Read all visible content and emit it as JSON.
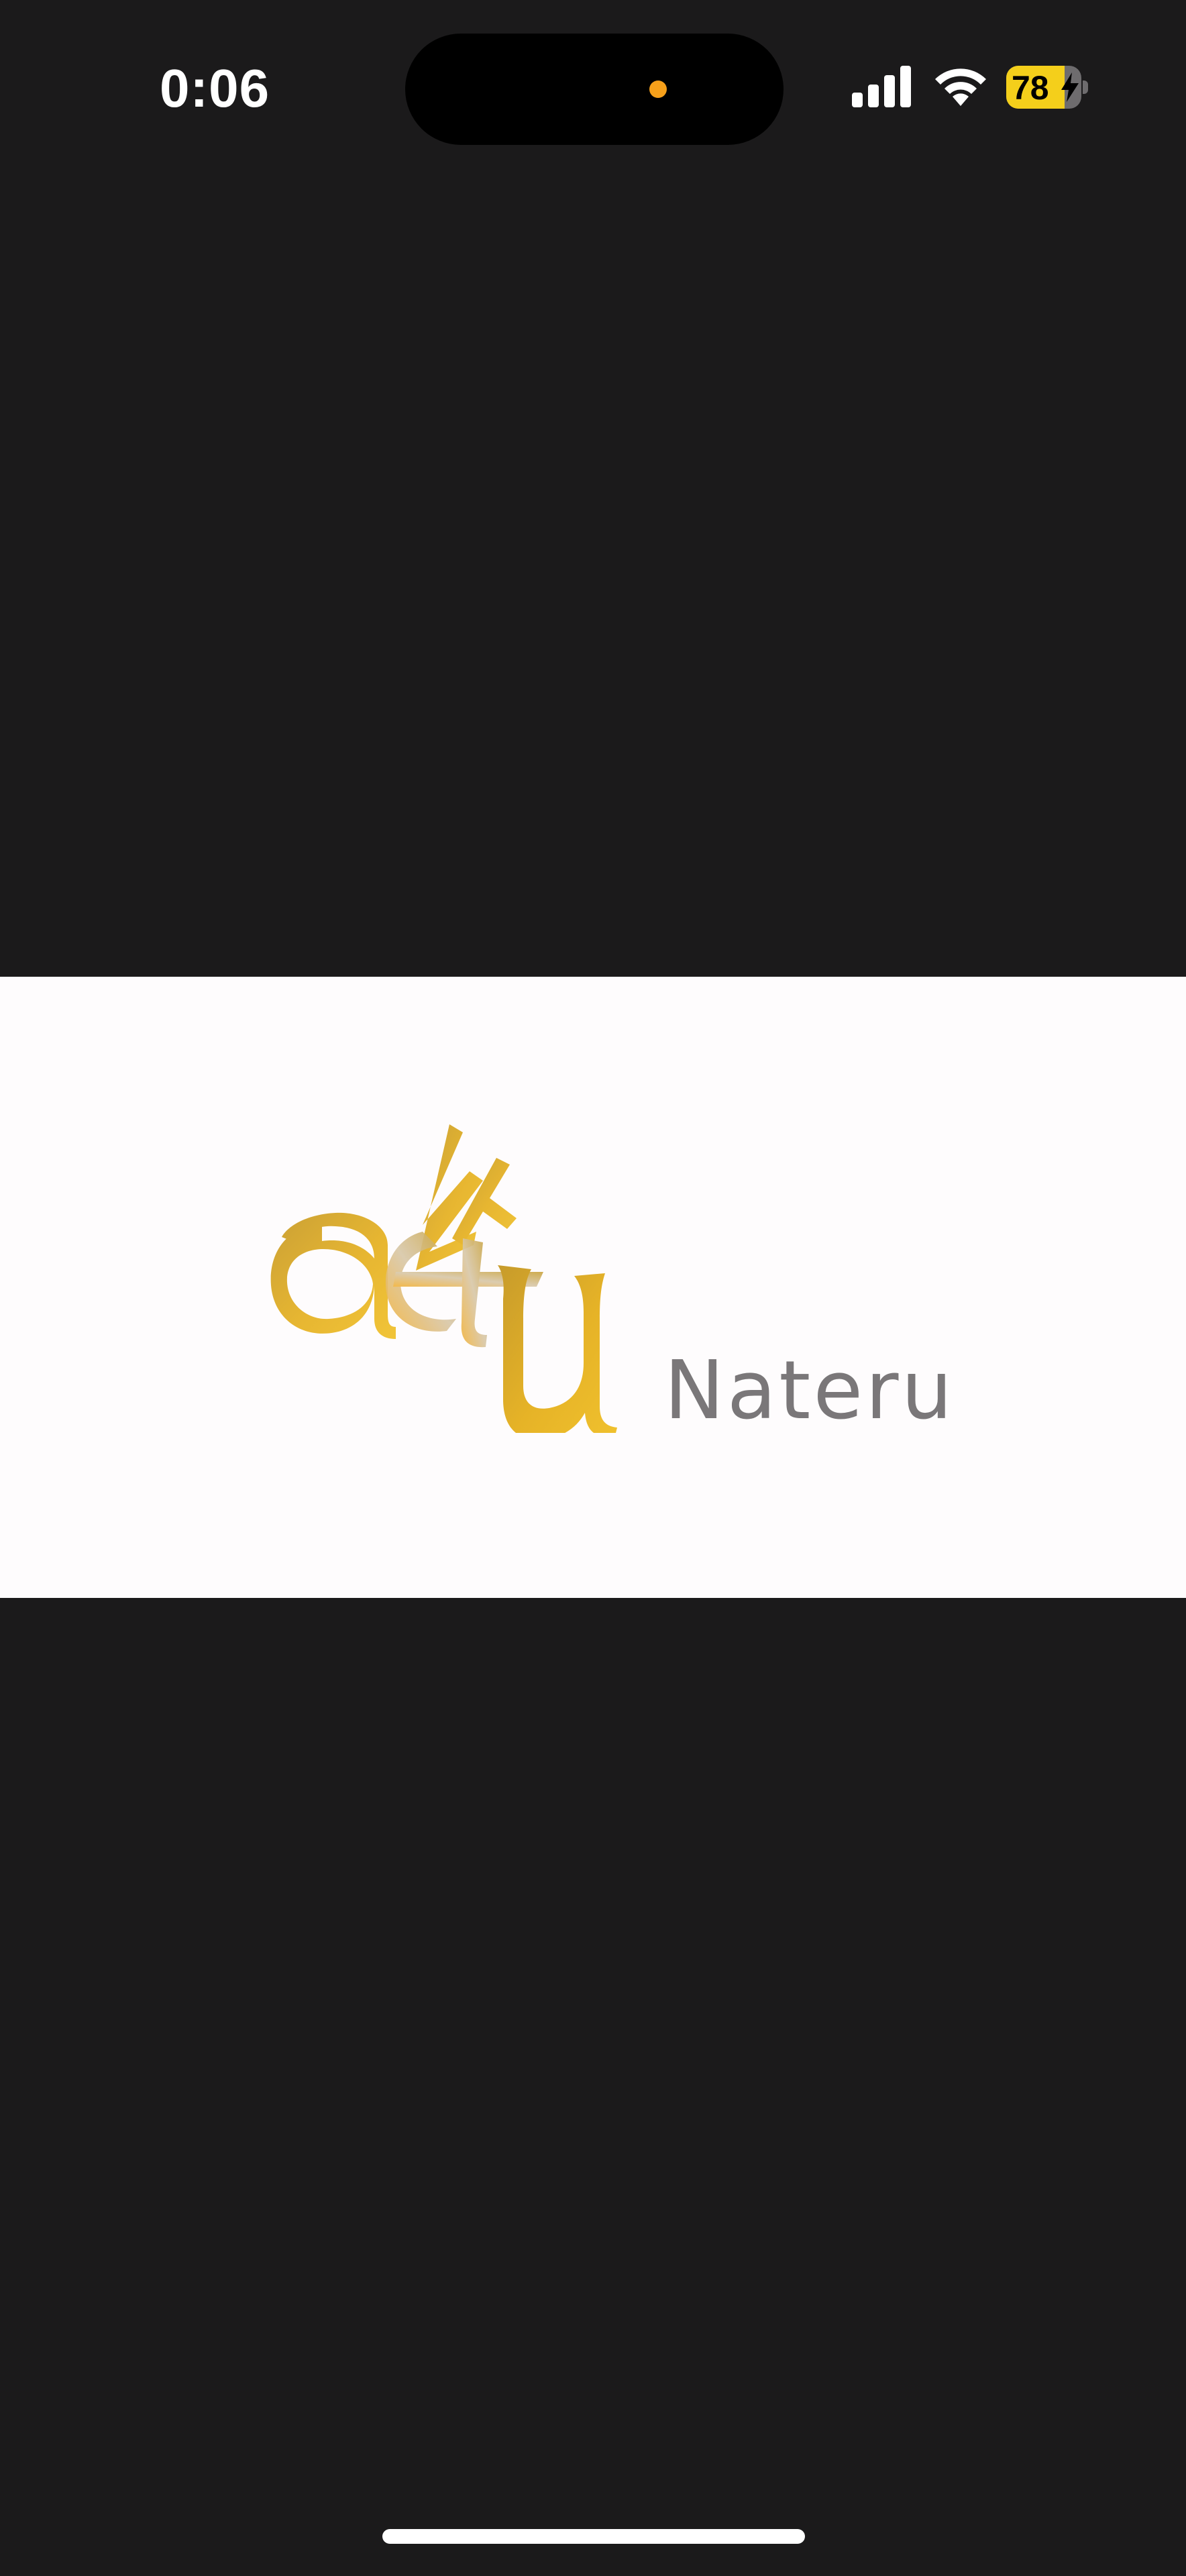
{
  "status_bar": {
    "time": "0:06",
    "battery_level": 78,
    "battery_label": "78",
    "battery_charging": true,
    "icons": [
      "signal-icon",
      "wifi-icon",
      "bolt-icon"
    ],
    "colors": {
      "battery_fill": "#f4cf1b",
      "privacy_dot": "#f6a01a"
    }
  },
  "splash": {
    "brand_name": "Nateru",
    "logo_colors": [
      "#c79b2b",
      "#e6b327",
      "#f0c12e",
      "#d8c7a8"
    ]
  }
}
